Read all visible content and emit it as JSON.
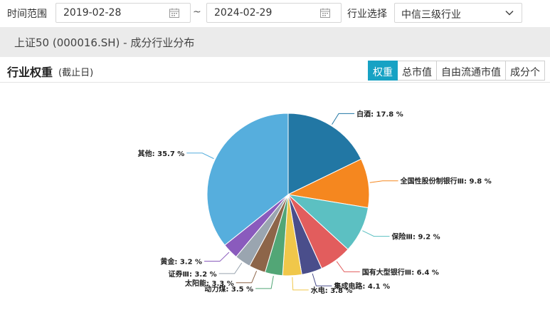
{
  "filters": {
    "time_range_label": "时间范围",
    "start_date": "2019-02-28",
    "range_separator": "~",
    "end_date": "2024-02-29",
    "industry_label": "行业选择",
    "industry_value": "中信三级行业"
  },
  "title_bar": {
    "title": "上证50 (000016.SH) - 成分行业分布"
  },
  "section": {
    "title": "行业权重",
    "subtitle": "(截止日)",
    "tabs": [
      {
        "label": "权重",
        "active": true
      },
      {
        "label": "总市值",
        "active": false
      },
      {
        "label": "自由流通市值",
        "active": false
      },
      {
        "label": "成分个",
        "active": false
      }
    ]
  },
  "chart_data": {
    "type": "pie",
    "unit": "%",
    "slices": [
      {
        "name": "白酒",
        "value": 17.8,
        "label": "白酒: 17.8 %",
        "color": "#2277a4"
      },
      {
        "name": "全国性股份制银行Ⅲ",
        "value": 9.8,
        "label": "全国性股份制银行Ⅲ: 9.8 %",
        "color": "#f5871f"
      },
      {
        "name": "保险Ⅲ",
        "value": 9.2,
        "label": "保险Ⅲ: 9.2 %",
        "color": "#5cc0c2"
      },
      {
        "name": "国有大型银行Ⅲ",
        "value": 6.4,
        "label": "国有大型银行Ⅲ: 6.4 %",
        "color": "#e25d5d"
      },
      {
        "name": "集成电路",
        "value": 4.1,
        "label": "集成电路: 4.1 %",
        "color": "#4a4e8b"
      },
      {
        "name": "水电",
        "value": 3.8,
        "label": "水电: 3.8 %",
        "color": "#f0c74a"
      },
      {
        "name": "动力煤",
        "value": 3.5,
        "label": "动力煤: 3.5 %",
        "color": "#52a676"
      },
      {
        "name": "太阳能",
        "value": 3.3,
        "label": "太阳能: 3.3 %",
        "color": "#8d6549"
      },
      {
        "name": "证券Ⅲ",
        "value": 3.2,
        "label": "证券Ⅲ: 3.2 %",
        "color": "#9aa5b0"
      },
      {
        "name": "黄金",
        "value": 3.2,
        "label": "黄金: 3.2 %",
        "color": "#8a5bbd"
      },
      {
        "name": "其他",
        "value": 35.7,
        "label": "其他: 35.7 %",
        "color": "#56aedd"
      }
    ]
  }
}
